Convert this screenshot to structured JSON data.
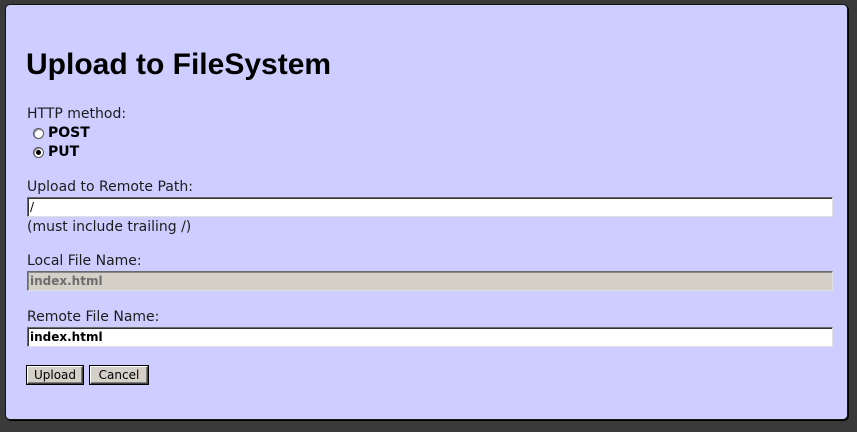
{
  "form": {
    "title": "Upload to FileSystem",
    "http_method_label": "HTTP method:",
    "methods": [
      {
        "label": "POST",
        "checked": false
      },
      {
        "label": "PUT",
        "checked": true
      }
    ],
    "remote_path": {
      "label": "Upload to Remote Path:",
      "value": "/",
      "hint": "(must include trailing /)"
    },
    "local_file": {
      "label": "Local File Name:",
      "value": "index.html",
      "disabled": true
    },
    "remote_file": {
      "label": "Remote File Name:",
      "value": "index.html"
    },
    "buttons": {
      "upload": "Upload",
      "cancel": "Cancel"
    }
  }
}
